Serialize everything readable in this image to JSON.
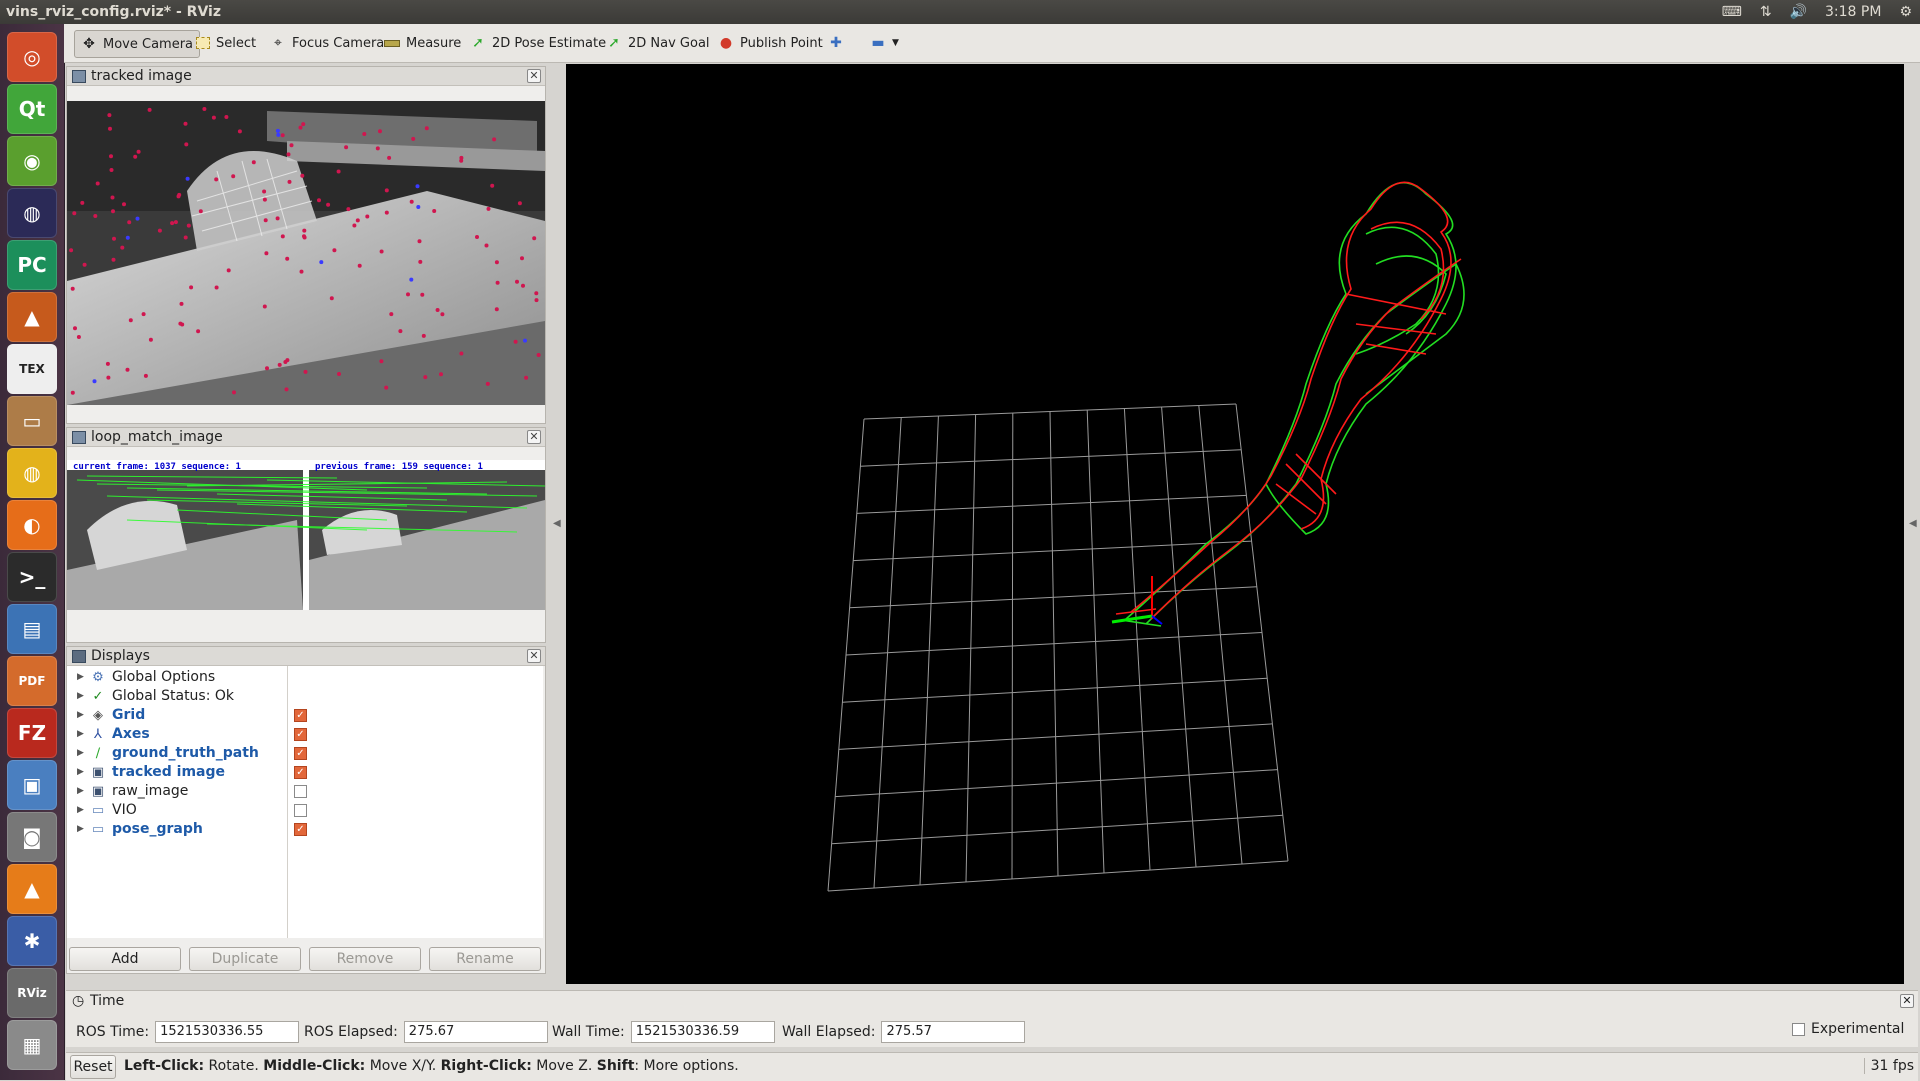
{
  "window_title": "vins_rviz_config.rviz* - RViz",
  "tray": {
    "time": "3:18 PM"
  },
  "launcher": [
    {
      "name": "ubuntu-logo-icon",
      "glyph": "◎",
      "color": "#d24d2a"
    },
    {
      "name": "qt-creator-icon",
      "glyph": "Qt",
      "color": "#41a63a"
    },
    {
      "name": "rviz-green-icon",
      "glyph": "◉",
      "color": "#5a9f2e"
    },
    {
      "name": "eclipse-icon",
      "glyph": "◍",
      "color": "#2b2a57"
    },
    {
      "name": "pycharm-icon",
      "glyph": "PC",
      "color": "#1c8f5b"
    },
    {
      "name": "matlab-icon",
      "glyph": "▲",
      "color": "#c65a1c"
    },
    {
      "name": "tex-icon",
      "glyph": "TEX",
      "color": "#eeeeee"
    },
    {
      "name": "files-icon",
      "glyph": "▭",
      "color": "#ad7c48"
    },
    {
      "name": "chrome-icon",
      "glyph": "◍",
      "color": "#e3b21b"
    },
    {
      "name": "firefox-icon",
      "glyph": "◐",
      "color": "#e66d19"
    },
    {
      "name": "terminal-icon",
      "glyph": ">_",
      "color": "#2b2b2b"
    },
    {
      "name": "document-viewer-icon",
      "glyph": "▤",
      "color": "#3c73b5"
    },
    {
      "name": "pdf-icon",
      "glyph": "PDF",
      "color": "#d46b2c"
    },
    {
      "name": "filezilla-icon",
      "glyph": "FZ",
      "color": "#b9291e"
    },
    {
      "name": "remote-desktop-icon",
      "glyph": "▣",
      "color": "#4a7fc0"
    },
    {
      "name": "camera-icon",
      "glyph": "◙",
      "color": "#777777"
    },
    {
      "name": "vlc-icon",
      "glyph": "▲",
      "color": "#e67c19"
    },
    {
      "name": "ros-icon",
      "glyph": "✱",
      "color": "#3a5da6"
    },
    {
      "name": "rviz-icon",
      "glyph": "RViz",
      "color": "#6a6a6a"
    },
    {
      "name": "trash-icon",
      "glyph": "▦",
      "color": "#8a8a8a"
    }
  ],
  "toolbar": {
    "move_camera": "Move Camera",
    "select": "Select",
    "focus_camera": "Focus Camera",
    "measure": "Measure",
    "pose_estimate": "2D Pose Estimate",
    "nav_goal": "2D Nav Goal",
    "publish_point": "Publish Point"
  },
  "panels": {
    "tracked_image": "tracked image",
    "loop_match_image": "loop_match_image",
    "loop_current": "current frame: 1037   sequence: 1",
    "loop_previous": "previous frame: 159   sequence: 1",
    "displays": "Displays"
  },
  "displays": [
    {
      "label": "Global Options",
      "icon": "⚙",
      "icon_name": "gear-icon",
      "icon_color": "#4a73b5",
      "blue": false,
      "checkbox": null
    },
    {
      "label": "Global Status: Ok",
      "icon": "✓",
      "icon_name": "checkmark-icon",
      "icon_color": "#1f8a1f",
      "blue": false,
      "checkbox": null
    },
    {
      "label": "Grid",
      "icon": "◈",
      "icon_name": "grid-icon",
      "icon_color": "#555555",
      "blue": true,
      "checkbox": true
    },
    {
      "label": "Axes",
      "icon": "⅄",
      "icon_name": "axes-icon",
      "icon_color": "#2d4fa0",
      "blue": true,
      "checkbox": true
    },
    {
      "label": "ground_truth_path",
      "icon": "∕",
      "icon_name": "path-icon",
      "icon_color": "#2aa82a",
      "blue": true,
      "checkbox": true
    },
    {
      "label": "tracked image",
      "icon": "▣",
      "icon_name": "image-icon",
      "icon_color": "#3d5170",
      "blue": true,
      "checkbox": true
    },
    {
      "label": "raw_image",
      "icon": "▣",
      "icon_name": "image-icon",
      "icon_color": "#3d5170",
      "blue": false,
      "checkbox": false
    },
    {
      "label": "VIO",
      "icon": "▭",
      "icon_name": "folder-icon",
      "icon_color": "#6688bb",
      "blue": false,
      "checkbox": false
    },
    {
      "label": "pose_graph",
      "icon": "▭",
      "icon_name": "folder-icon",
      "icon_color": "#6688bb",
      "blue": true,
      "checkbox": true
    }
  ],
  "buttons": {
    "add": "Add",
    "duplicate": "Duplicate",
    "remove": "Remove",
    "rename": "Rename"
  },
  "time": {
    "title": "Time",
    "ros_time_label": "ROS Time:",
    "ros_time": "1521530336.55",
    "ros_elapsed_label": "ROS Elapsed:",
    "ros_elapsed": "275.67",
    "wall_time_label": "Wall Time:",
    "wall_time": "1521530336.59",
    "wall_elapsed_label": "Wall Elapsed:",
    "wall_elapsed": "275.57",
    "experimental": "Experimental"
  },
  "status": {
    "reset": "Reset",
    "left_click": "Left-Click:",
    "left_click_desc": "Rotate.",
    "middle_click": "Middle-Click:",
    "middle_click_desc": "Move X/Y.",
    "right_click": "Right-Click:",
    "right_click_desc": "Move Z.",
    "shift": "Shift",
    "shift_desc": ": More options.",
    "fps": "31 fps"
  },
  "colors": {
    "accent_checkbox": "#e2673a",
    "trajectory_red": "#ff1a1a",
    "trajectory_green": "#22dd22",
    "link_blue": "#1e5aa8"
  }
}
